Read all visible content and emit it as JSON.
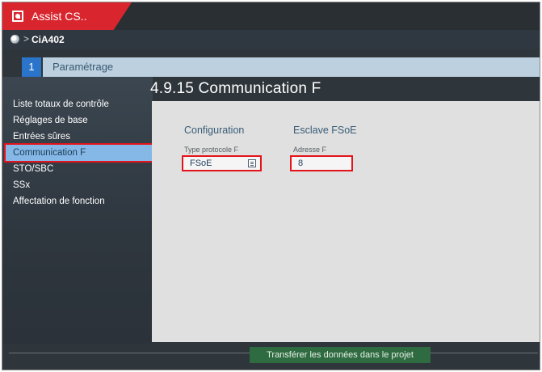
{
  "app": {
    "title": "Assist CS.."
  },
  "breadcrumb": {
    "separator": ">",
    "current": "CiA402"
  },
  "step": {
    "number": "1",
    "label": "Paramétrage"
  },
  "page": {
    "title": "4.9.15 Communication F"
  },
  "sidebar": {
    "items": [
      {
        "label": "Liste totaux de contrôle",
        "active": false
      },
      {
        "label": "Réglages de base",
        "active": false
      },
      {
        "label": "Entrées sûres",
        "active": false
      },
      {
        "label": "Communication F",
        "active": true
      },
      {
        "label": "STO/SBC",
        "active": false
      },
      {
        "label": "SSx",
        "active": false
      },
      {
        "label": "Affectation de fonction",
        "active": false
      }
    ]
  },
  "configuration": {
    "title": "Configuration",
    "protocol_label": "Type protocole F",
    "protocol_value": "FSoE"
  },
  "slave": {
    "title": "Esclave FSoE",
    "address_label": "Adresse F",
    "address_value": "8"
  },
  "footer": {
    "transfer_label": "Transférer les données dans le projet"
  },
  "colors": {
    "brand": "#d9262e",
    "highlight": "#e3141b",
    "active_item": "#85b8e6",
    "transfer_button": "#2f6b41"
  }
}
